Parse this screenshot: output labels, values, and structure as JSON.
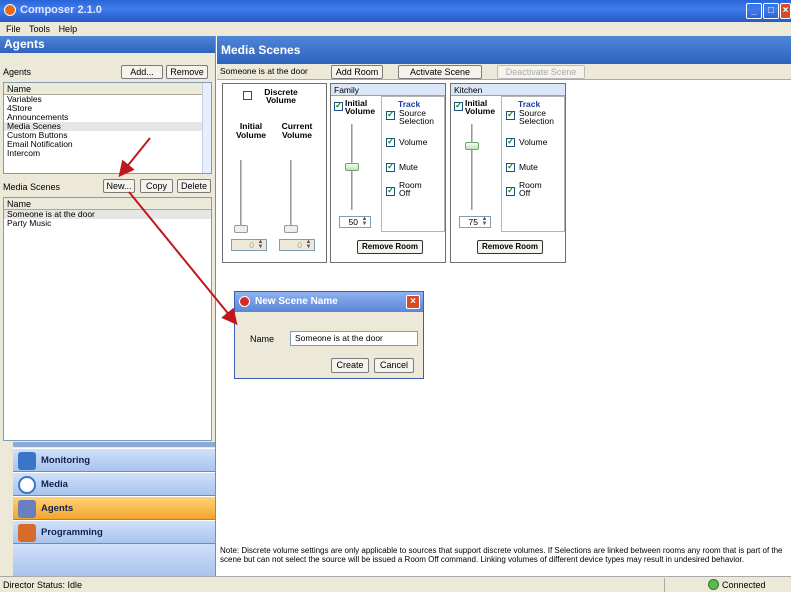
{
  "window": {
    "title": "Composer 2.1.0"
  },
  "menu": [
    "File",
    "Tools",
    "Help"
  ],
  "left": {
    "header": "Agents",
    "agents_label": "Agents",
    "add_btn": "Add...",
    "remove_btn": "Remove",
    "agents_col": "Name",
    "agents": [
      "Variables",
      "4Store",
      "Announcements",
      "Media Scenes",
      "Custom Buttons",
      "Email Notification",
      "Intercom"
    ],
    "scenes_label": "Media Scenes",
    "new_btn": "New...",
    "copy_btn": "Copy",
    "delete_btn": "Delete",
    "scenes_col": "Name",
    "scenes": [
      "Someone is at the door",
      "Party Music"
    ],
    "nav": [
      {
        "label": "Monitoring",
        "icon": "monitoring-icon"
      },
      {
        "label": "Media",
        "icon": "media-icon"
      },
      {
        "label": "Agents",
        "icon": "agents-icon"
      },
      {
        "label": "Programming",
        "icon": "programming-icon"
      }
    ]
  },
  "main": {
    "header": "Media Scenes",
    "scene_name": "Someone is at the door",
    "add_room": "Add Room",
    "activate": "Activate Scene",
    "deactivate": "Deactivate Scene",
    "discrete": {
      "label": "Discrete Volume",
      "initial": "Initial Volume",
      "current": "Current Volume",
      "initial_value": "0",
      "current_value": "0"
    },
    "rooms": [
      {
        "name": "Family",
        "volume": "50",
        "volume_level": 0.5,
        "remove": "Remove Room"
      },
      {
        "name": "Kitchen",
        "volume": "75",
        "volume_level": 0.75,
        "remove": "Remove Room"
      }
    ],
    "room_labels": {
      "initial_volume": "Initial Volume",
      "track": "Track",
      "source_selection": "Source Selection",
      "volume": "Volume",
      "mute": "Mute",
      "room_off": "Room Off"
    },
    "note": "Note:  Discrete volume settings are only applicable to sources that support discrete volumes.  If Selections are linked between rooms any room that is part of the scene but can not select the source will be issued a Room Off command. Linking volumes of different device types may result in undesired behavior."
  },
  "dialog": {
    "title": "New Scene Name",
    "name_label": "Name",
    "name_value": "Someone is at the door",
    "create": "Create",
    "cancel": "Cancel"
  },
  "status": {
    "director": "Director Status: Idle",
    "connection": "Connected"
  }
}
